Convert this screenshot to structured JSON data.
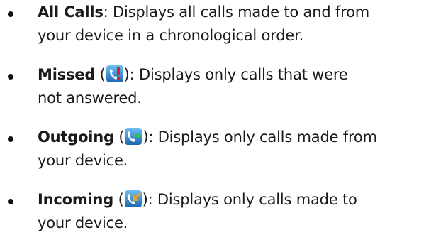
{
  "items": [
    {
      "term": "All Calls",
      "desc": ": Displays all calls made to and from",
      "desc2": "your device in a chronological order."
    },
    {
      "term": "Missed",
      "icon": "missed-call-icon",
      "desc": "): Displays only calls that were",
      "desc2": "not answered."
    },
    {
      "term": "Outgoing",
      "icon": "outgoing-call-icon",
      "desc": "): Displays only calls made from",
      "desc2": "your device."
    },
    {
      "term": "Incoming",
      "icon": "incoming-call-icon",
      "desc": "): Displays only calls made to",
      "desc2": "your device."
    }
  ],
  "colors": {
    "icon_bg_top": "#5fb8f0",
    "icon_bg_bottom": "#1f6fb8",
    "missed_mark": "#e0201b",
    "outgoing_arrow": "#3cc43c",
    "incoming_arrow": "#f0a020"
  }
}
